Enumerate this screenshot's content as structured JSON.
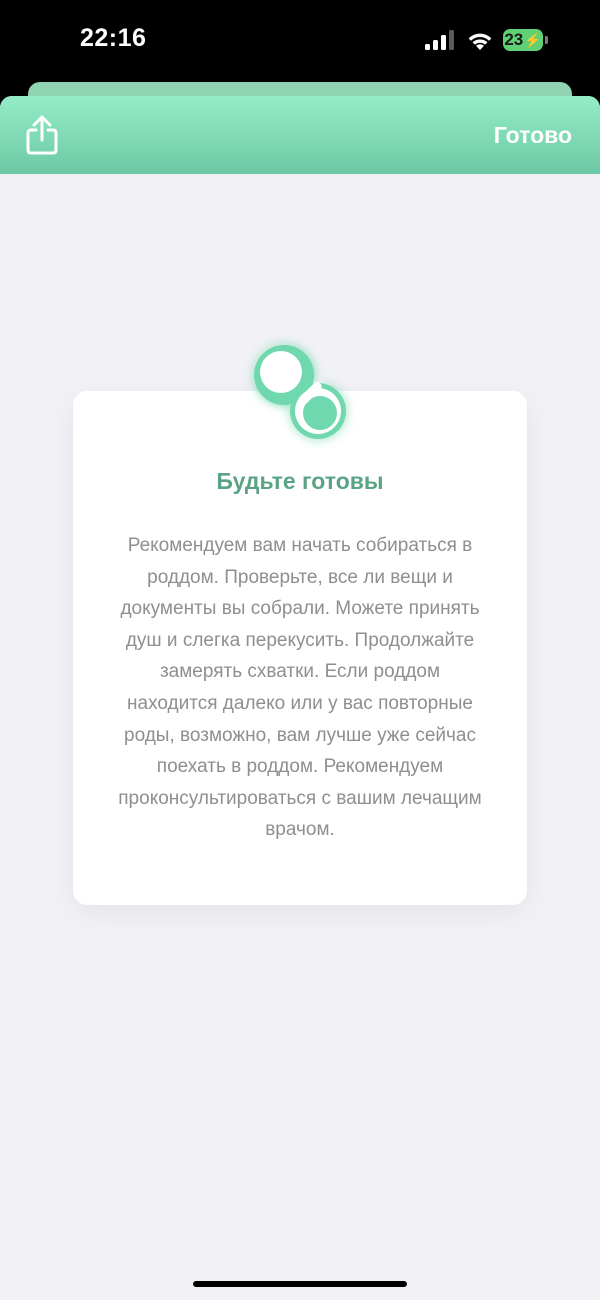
{
  "status_bar": {
    "time": "22:16",
    "battery_level": "23",
    "battery_color": "#5fd074",
    "signal_icon": "cellular-signal-icon",
    "wifi_icon": "wifi-icon",
    "charging_icon": "bolt-icon"
  },
  "header": {
    "share_icon": "share-icon",
    "done_label": "Готово",
    "gradient_top": "#93ecc6",
    "gradient_bottom": "#6dc9a5"
  },
  "card": {
    "icon": "pacifier-icon",
    "title": "Будьте готовы",
    "body": "Рекомендуем вам начать собираться в роддом. Проверьте, все ли вещи и документы вы собрали. Можете принять душ и слегка перекусить. Продолжайте замерять схватки. Если роддом находится далеко или у вас повторные роды, возможно, вам лучше уже сейчас поехать в роддом. Рекомендуем проконсультироваться с вашим лечащим врачом.",
    "title_color": "#5ba386",
    "accent_color": "#6fd8ae"
  }
}
